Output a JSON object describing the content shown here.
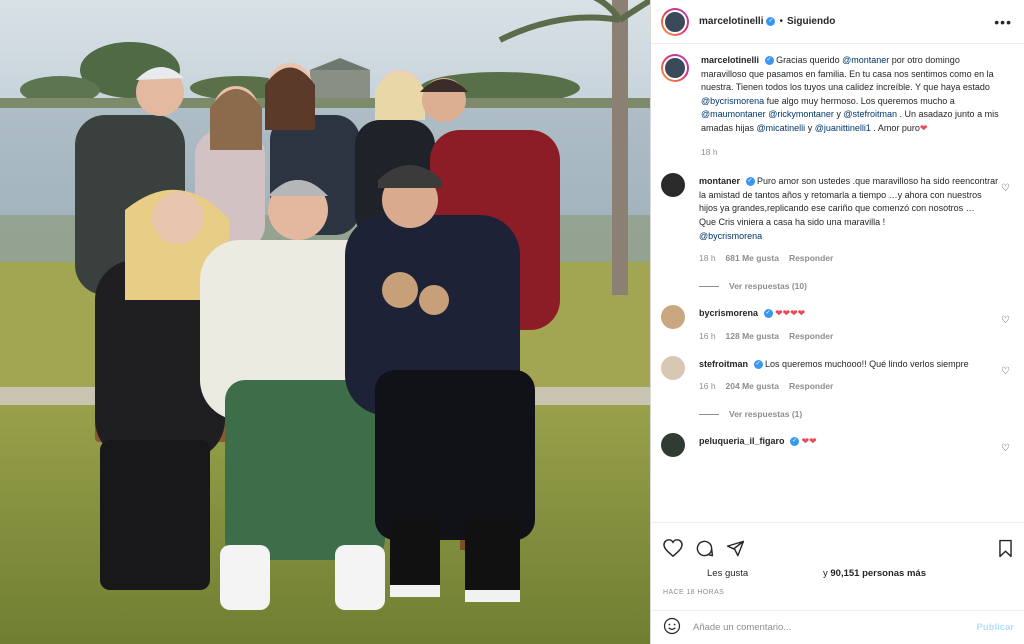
{
  "post": {
    "photo_alt": "Family group photo outdoors by a lake",
    "header": {
      "username": "marcelotinelli",
      "separator": "•",
      "follow_label": "Siguiendo",
      "more_icon": "more-horizontal-icon"
    },
    "caption": {
      "username": "marcelotinelli",
      "parts": [
        {
          "t": "Gracias querido "
        },
        {
          "t": "@montaner",
          "m": true
        },
        {
          "t": " por otro domingo maravilloso que pasamos en familia. En tu casa nos sentimos como en la nuestra. Tienen todos los tuyos una calidez increíble. Y que haya estado "
        },
        {
          "t": "@bycrismorena",
          "m": true
        },
        {
          "t": " fue algo muy hermoso. Los queremos mucho a "
        },
        {
          "t": "@maumontaner",
          "m": true
        },
        {
          "t": " "
        },
        {
          "t": "@rickymontaner",
          "m": true
        },
        {
          "t": " y "
        },
        {
          "t": "@stefroitman",
          "m": true
        },
        {
          "t": " . Un asadazo junto a mis amadas hijas "
        },
        {
          "t": "@micatinelli",
          "m": true
        },
        {
          "t": " y "
        },
        {
          "t": "@juanittinelli1",
          "m": true
        },
        {
          "t": " . Amor puro"
        },
        {
          "t": "❤",
          "h": true
        }
      ],
      "time": "18 h"
    },
    "comments": [
      {
        "username": "montaner",
        "verified": true,
        "text": "Puro amor son ustedes .que maravilloso ha sido reencontrar la amistad de tantos años y retomarla a tiempo …y ahora con nuestros hijos ya grandes,replicando ese cariño que comenzó con nosotros …\nQue Cris viniera a casa ha sido una maravilla !",
        "mention": "@bycrismorena",
        "time": "18 h",
        "likes": "681 Me gusta",
        "reply": "Responder",
        "view_replies": "Ver respuestas (10)"
      },
      {
        "username": "bycrismorena",
        "verified": true,
        "text": "❤❤❤❤",
        "time": "16 h",
        "likes": "128 Me gusta",
        "reply": "Responder"
      },
      {
        "username": "stefroitman",
        "verified": true,
        "text": "Los queremos muchooo!! Qué lindo verlos siempre",
        "time": "16 h",
        "likes": "204 Me gusta",
        "reply": "Responder",
        "view_replies": "Ver respuestas (1)"
      },
      {
        "username": "peluqueria_il_figaro",
        "verified": true,
        "text": "❤❤"
      }
    ],
    "likes_text_left": "Les gusta",
    "likes_text_right_prefix": "y ",
    "likes_count": "90,151 personas más",
    "timestamp": "HACE 18 HORAS",
    "comment_placeholder": "Añade un comentario...",
    "publish_label": "Publicar",
    "colors": {
      "link": "#00376b",
      "verified": "#3897f0",
      "heart": "#ed4956",
      "publish": "#b2dffc"
    }
  }
}
